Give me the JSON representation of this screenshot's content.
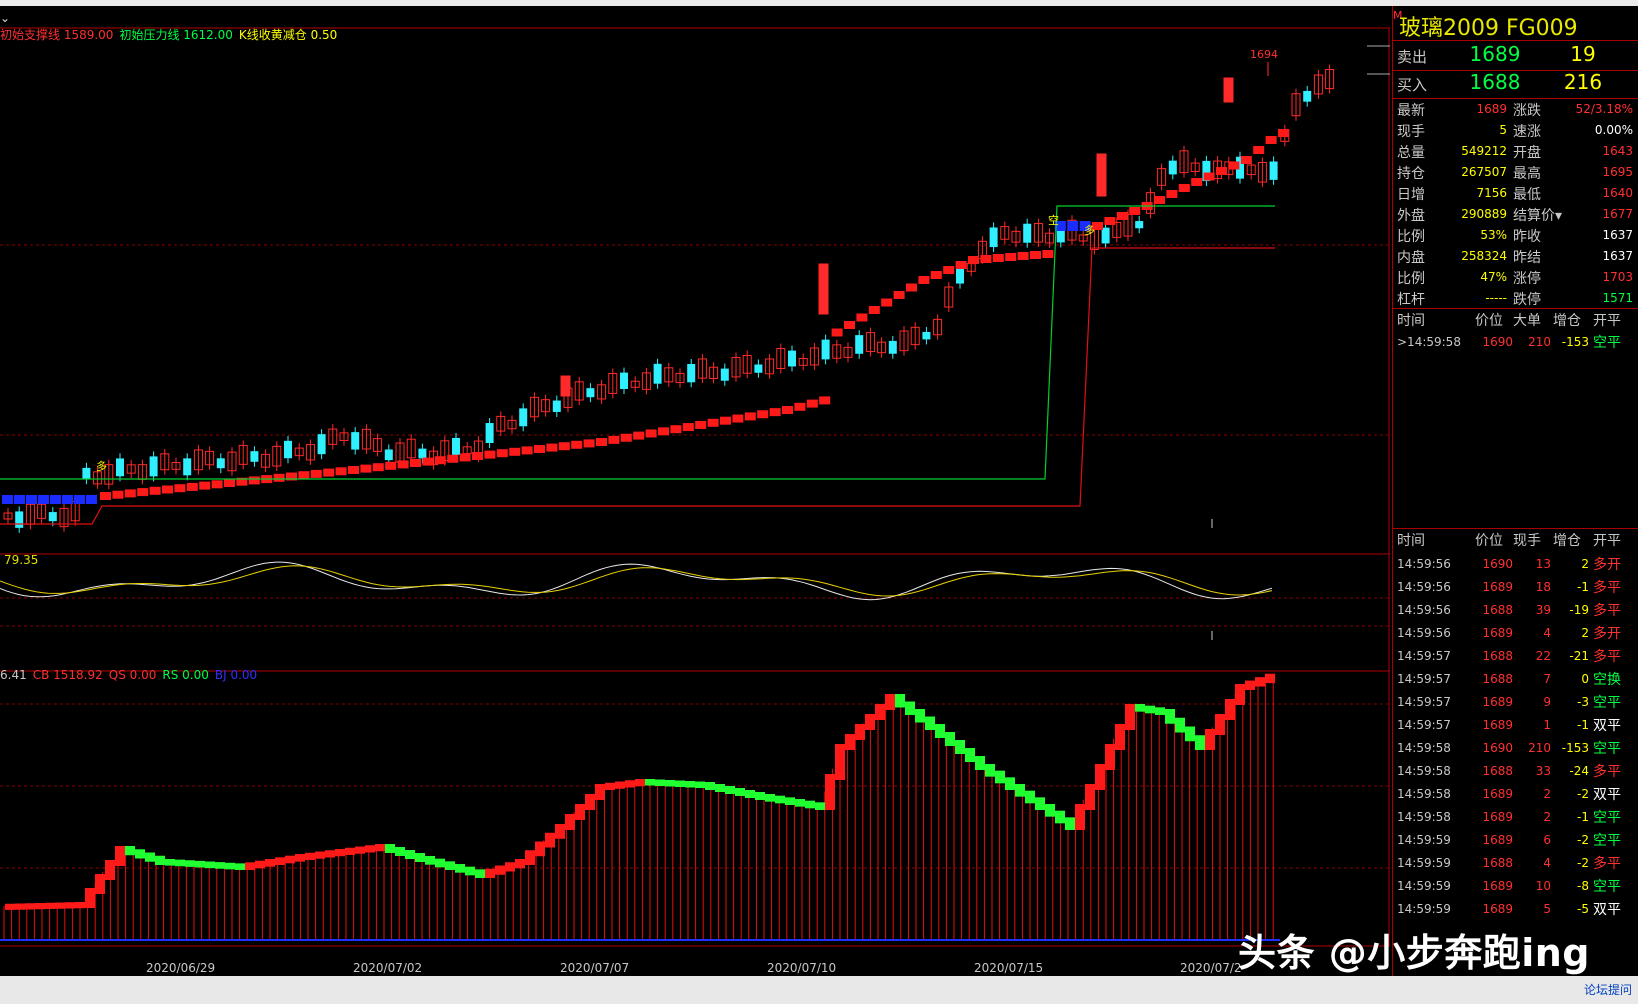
{
  "legend_main": [
    {
      "text": "初始支撑线 1589.00",
      "color": "#ff3030"
    },
    {
      "text": "初始压力线 1612.00",
      "color": "#00ff40"
    },
    {
      "text": "K线收黄减仓 0.50",
      "color": "#ffff00"
    }
  ],
  "osc_value": "79.35",
  "legend_vol": [
    {
      "text": "6.41",
      "color": "#c8c8c8"
    },
    {
      "text": "CB 1518.92",
      "color": "#ff3030"
    },
    {
      "text": "QS 0.00",
      "color": "#ff3030"
    },
    {
      "text": "RS 0.00",
      "color": "#00ff40"
    },
    {
      "text": "BJ 0.00",
      "color": "#3030ff"
    }
  ],
  "x_ticks": [
    "2020/06/29",
    "2020/07/02",
    "2020/07/07",
    "2020/07/10",
    "2020/07/15",
    "2020/07/2"
  ],
  "price_marker": "1694",
  "markers": {
    "duo": "多",
    "kong": "空"
  },
  "watermark": "头条 @小步奔跑ing",
  "quote": {
    "m_badge": "M",
    "title": "玻璃2009  FG009",
    "sell": {
      "label": "卖出",
      "price": "1689",
      "vol": "19"
    },
    "buy": {
      "label": "买入",
      "price": "1688",
      "vol": "216"
    },
    "stats": [
      {
        "l1": "最新",
        "v1": "1689",
        "c1": "#ff3030",
        "l2": "涨跌",
        "v2": "52/3.18%",
        "c2": "#ff3030"
      },
      {
        "l1": "现手",
        "v1": "5",
        "c1": "#ffff00",
        "l2": "速涨",
        "v2": "0.00%",
        "c2": "#ffffff"
      },
      {
        "l1": "总量",
        "v1": "549212",
        "c1": "#ffff00",
        "l2": "开盘",
        "v2": "1643",
        "c2": "#ff3030"
      },
      {
        "l1": "持仓",
        "v1": "267507",
        "c1": "#ffff00",
        "l2": "最高",
        "v2": "1695",
        "c2": "#ff3030"
      },
      {
        "l1": "日增",
        "v1": "7156",
        "c1": "#ffff00",
        "l2": "最低",
        "v2": "1640",
        "c2": "#ff3030"
      },
      {
        "l1": "外盘",
        "v1": "290889",
        "c1": "#ffff00",
        "l2": "结算价▾",
        "v2": "1677",
        "c2": "#ff3030"
      },
      {
        "l1": "比例",
        "v1": "53%",
        "c1": "#ffff00",
        "l2": "昨收",
        "v2": "1637",
        "c2": "#ffffff"
      },
      {
        "l1": "内盘",
        "v1": "258324",
        "c1": "#ffff00",
        "l2": "昨结",
        "v2": "1637",
        "c2": "#ffffff"
      },
      {
        "l1": "比例",
        "v1": "47%",
        "c1": "#ffff00",
        "l2": "涨停",
        "v2": "1703",
        "c2": "#ff3030"
      },
      {
        "l1": "杠杆",
        "v1": "-----",
        "c1": "#ffff00",
        "l2": "跌停",
        "v2": "1571",
        "c2": "#00ff40"
      }
    ],
    "big_header": [
      "时间",
      "价位",
      "大单",
      "增仓",
      "开平"
    ],
    "big_rows": [
      {
        "time": ">14:59:58",
        "price": "1690",
        "vol": "210",
        "oi": "-153",
        "type": "空平",
        "tc": "#00ff40"
      }
    ],
    "tick_header": [
      "时间",
      "价位",
      "现手",
      "增仓",
      "开平"
    ],
    "ticks": [
      {
        "time": "14:59:56",
        "price": "1690",
        "vol": "13",
        "oi": "2",
        "type": "多开",
        "tc": "#ff3030"
      },
      {
        "time": "14:59:56",
        "price": "1689",
        "vol": "18",
        "oi": "-1",
        "type": "多平",
        "tc": "#ff3030"
      },
      {
        "time": "14:59:56",
        "price": "1688",
        "vol": "39",
        "oi": "-19",
        "type": "多平",
        "tc": "#ff3030"
      },
      {
        "time": "14:59:56",
        "price": "1689",
        "vol": "4",
        "oi": "2",
        "type": "多开",
        "tc": "#ff3030"
      },
      {
        "time": "14:59:57",
        "price": "1688",
        "vol": "22",
        "oi": "-21",
        "type": "多平",
        "tc": "#ff3030"
      },
      {
        "time": "14:59:57",
        "price": "1688",
        "vol": "7",
        "oi": "0",
        "type": "空换",
        "tc": "#00ff40"
      },
      {
        "time": "14:59:57",
        "price": "1689",
        "vol": "9",
        "oi": "-3",
        "type": "空平",
        "tc": "#00ff40"
      },
      {
        "time": "14:59:57",
        "price": "1689",
        "vol": "1",
        "oi": "-1",
        "type": "双平",
        "tc": "#ffffff"
      },
      {
        "time": "14:59:58",
        "price": "1690",
        "vol": "210",
        "oi": "-153",
        "type": "空平",
        "tc": "#00ff40"
      },
      {
        "time": "14:59:58",
        "price": "1688",
        "vol": "33",
        "oi": "-24",
        "type": "多平",
        "tc": "#ff3030"
      },
      {
        "time": "14:59:58",
        "price": "1689",
        "vol": "2",
        "oi": "-2",
        "type": "双平",
        "tc": "#ffffff"
      },
      {
        "time": "14:59:58",
        "price": "1689",
        "vol": "2",
        "oi": "-1",
        "type": "空平",
        "tc": "#00ff40"
      },
      {
        "time": "14:59:59",
        "price": "1689",
        "vol": "6",
        "oi": "-2",
        "type": "空平",
        "tc": "#00ff40"
      },
      {
        "time": "14:59:59",
        "price": "1688",
        "vol": "4",
        "oi": "-2",
        "type": "多平",
        "tc": "#ff3030"
      },
      {
        "time": "14:59:59",
        "price": "1689",
        "vol": "10",
        "oi": "-8",
        "type": "空平",
        "tc": "#00ff40"
      },
      {
        "time": "14:59:59",
        "price": "1689",
        "vol": "5",
        "oi": "-5",
        "type": "双平",
        "tc": "#ffffff"
      }
    ]
  },
  "forum_label": "论坛提问"
}
